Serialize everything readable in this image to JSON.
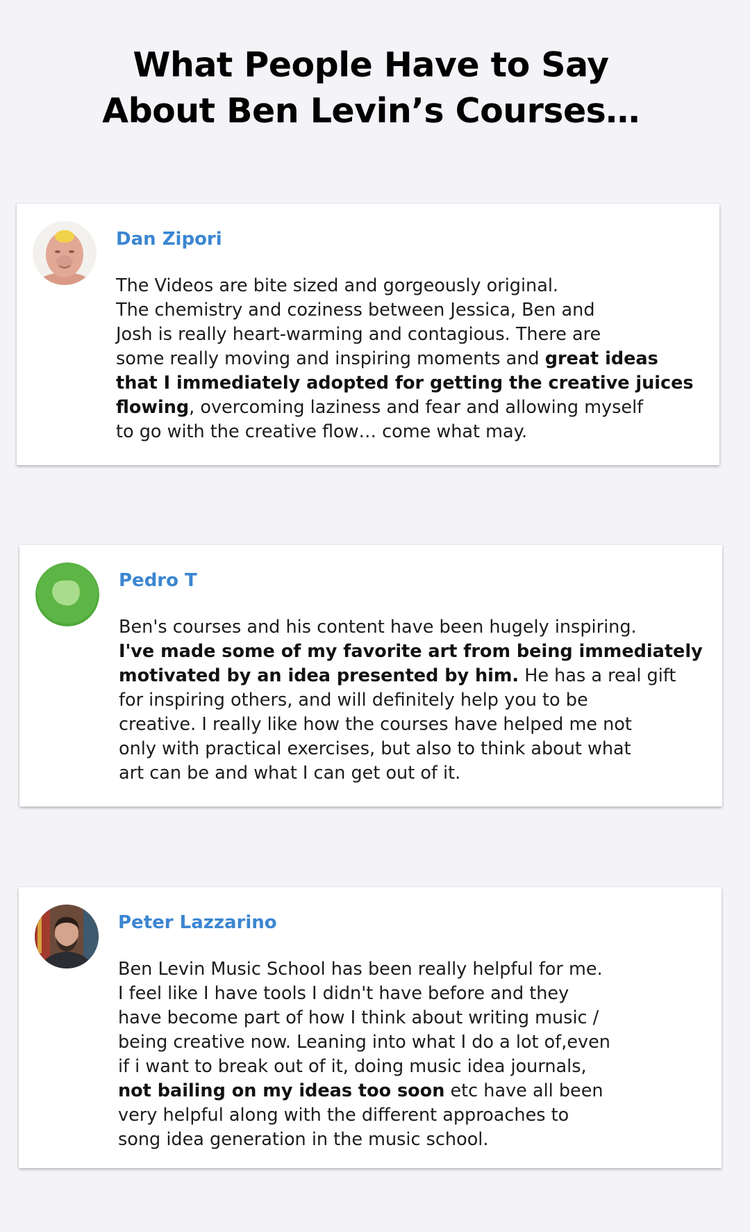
{
  "header": {
    "title_line1": "What People Have to Say",
    "title_line2": "About Ben Levin’s Courses…"
  },
  "testimonials": [
    {
      "name": "Dan Zipori",
      "avatar_icon": "person-photo-bald-man",
      "lines": [
        [
          "The Videos are bite sized and gorgeously original."
        ],
        [
          "The chemistry and coziness between Jessica, Ben and"
        ],
        [
          "Josh is really heart-warming and contagious. There are"
        ],
        [
          "some really moving and inspiring moments and ",
          "great ideas"
        ],
        [
          "",
          "that I immediately adopted for getting the creative juices"
        ],
        [
          "",
          "flowing",
          ", overcoming laziness and fear and allowing myself"
        ],
        [
          "to go with the creative flow… come what may."
        ]
      ]
    },
    {
      "name": "Pedro T",
      "avatar_icon": "green-circle-avatar-icon",
      "lines": [
        [
          "Ben's courses and his content have been hugely inspiring."
        ],
        [
          "",
          "I've made some of my favorite art from being immediately"
        ],
        [
          "",
          "motivated by an idea presented by him.",
          " He has a real gift"
        ],
        [
          "for inspiring others, and will definitely help you to be"
        ],
        [
          "creative. I really like how the courses have helped me not"
        ],
        [
          "only with practical exercises, but also to think about what"
        ],
        [
          "art can be and what I can get out of it."
        ]
      ]
    },
    {
      "name": "Peter Lazzarino",
      "avatar_icon": "person-photo-bearded-man",
      "lines": [
        [
          "Ben Levin Music School has been really helpful for me."
        ],
        [
          "I feel like I have tools I didn't have before and they"
        ],
        [
          "have become part of how I think about writing music /"
        ],
        [
          "being creative now. Leaning into what I do a lot of,even"
        ],
        [
          "if i want to break out of it, doing music idea journals,"
        ],
        [
          "",
          "not bailing on my ideas too soon",
          " etc have all been"
        ],
        [
          "very helpful along with the different approaches to"
        ],
        [
          "song idea generation in the music school."
        ]
      ]
    }
  ],
  "colors": {
    "background": "#f4f4f8",
    "name_accent": "#3b86d1",
    "card": "#ffffff",
    "text": "#1c1c1c"
  }
}
